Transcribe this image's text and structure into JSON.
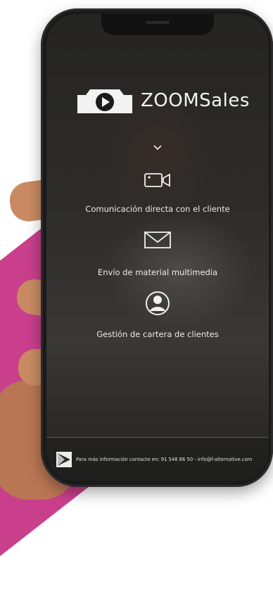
{
  "app": {
    "brand_name": "ZOOMSales"
  },
  "features": [
    {
      "label": "Comunicación directa con el cliente",
      "icon": "video-camera-icon"
    },
    {
      "label": "Envío de material multimedia",
      "icon": "envelope-icon"
    },
    {
      "label": "Gestión de cartera de clientes",
      "icon": "user-circle-icon"
    }
  ],
  "footer": {
    "text": "Para más información contacte en: 91 548 86 50 - info@f-alternative.com"
  },
  "colors": {
    "accent_pink": "#c93f8c",
    "phone_body": "#1a1a1a",
    "text_light": "#f0f0f0"
  }
}
